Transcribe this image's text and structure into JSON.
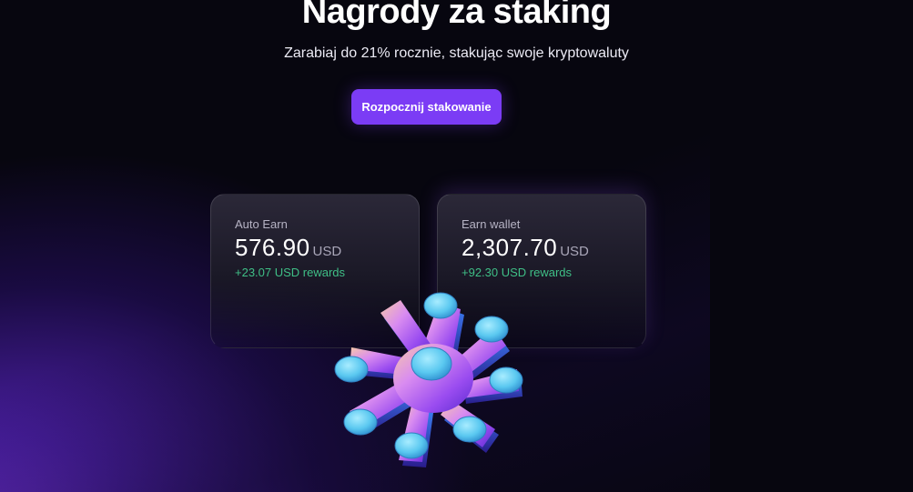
{
  "hero": {
    "title": "Nagrody za staking",
    "subtitle": "Zarabiaj do 21% rocznie, stakując swoje kryptowaluty",
    "cta_label": "Rozpocznij stakowanie"
  },
  "cards": [
    {
      "label": "Auto Earn",
      "amount": "576.90",
      "currency": "USD",
      "rewards": "+23.07 USD rewards"
    },
    {
      "label": "Earn wallet",
      "amount": "2,307.70",
      "currency": "USD",
      "rewards": "+92.30 USD rewards"
    }
  ],
  "colors": {
    "background": "#07060f",
    "accent": "#7b3cf5",
    "rewards_green": "#3fbf86"
  },
  "decor": {
    "illustration": "asterisk-token-icon"
  }
}
